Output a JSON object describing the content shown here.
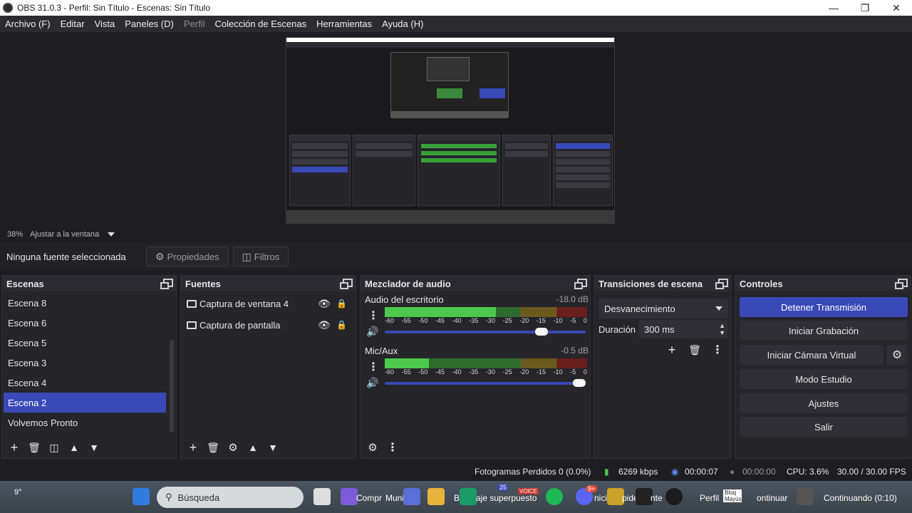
{
  "window": {
    "title": "OBS 31.0.3 - Perfil: Sin Título - Escenas: Sin Título"
  },
  "menu": {
    "items": [
      "Archivo (F)",
      "Editar",
      "Vista",
      "Paneles (D)",
      "Perfil",
      "Colección de Escenas",
      "Herramientas",
      "Ayuda (H)"
    ]
  },
  "preview": {
    "zoom_percent": "38%",
    "zoom_mode": "Ajustar a la ventana"
  },
  "source_toolbar": {
    "no_source": "Ninguna fuente seleccionada",
    "properties": "Propiedades",
    "filters": "Filtros"
  },
  "scenes": {
    "title": "Escenas",
    "items": [
      "Escena 8",
      "Escena 6",
      "Escena 5",
      "Escena 3",
      "Escena 4",
      "Escena 2",
      "Volvemos Pronto"
    ],
    "selected_index": 5
  },
  "sources": {
    "title": "Fuentes",
    "items": [
      "Captura de ventana 4",
      "Captura de pantalla"
    ]
  },
  "mixer": {
    "title": "Mezclador de audio",
    "channels": [
      {
        "name": "Audio del escritorio",
        "db": "-18.0 dB",
        "level": 0.55,
        "volume": 0.8
      },
      {
        "name": "Mic/Aux",
        "db": "-0.5 dB",
        "level": 0.22,
        "volume": 1.0
      }
    ],
    "ticks": [
      "-60",
      "-55",
      "-50",
      "-45",
      "-40",
      "-35",
      "-30",
      "-25",
      "-20",
      "-15",
      "-10",
      "-5",
      "0"
    ]
  },
  "transitions": {
    "title": "Transiciones de escena",
    "selected": "Desvanecimiento",
    "duration_label": "Duración",
    "duration_value": "300 ms"
  },
  "controls": {
    "title": "Controles",
    "stop_stream": "Detener Transmisión",
    "start_recording": "Iniciar Grabación",
    "start_virtual_cam": "Iniciar Cámara Virtual",
    "studio_mode": "Modo Estudio",
    "settings": "Ajustes",
    "exit": "Salir"
  },
  "status": {
    "dropped_frames": "Fotogramas Perdidos 0 (0.0%)",
    "bitrate": "6269 kbps",
    "stream_time": "00:00:07",
    "rec_time": "00:00:00",
    "cpu": "CPU: 3.6%",
    "fps": "30.00 / 30.00 FPS"
  },
  "taskbar": {
    "weather": "9°",
    "search_placeholder": "Búsqueda",
    "labels": [
      "Compr",
      "Muni",
      "B",
      "aje superpuesto",
      "nicia",
      "pide",
      "nte",
      "Perfil",
      "Bloq Mayús",
      "ontinuar",
      "Continuando (0:10)"
    ],
    "badge_25": "25",
    "badge_voice": "VOICE",
    "badge_9": "9+"
  }
}
